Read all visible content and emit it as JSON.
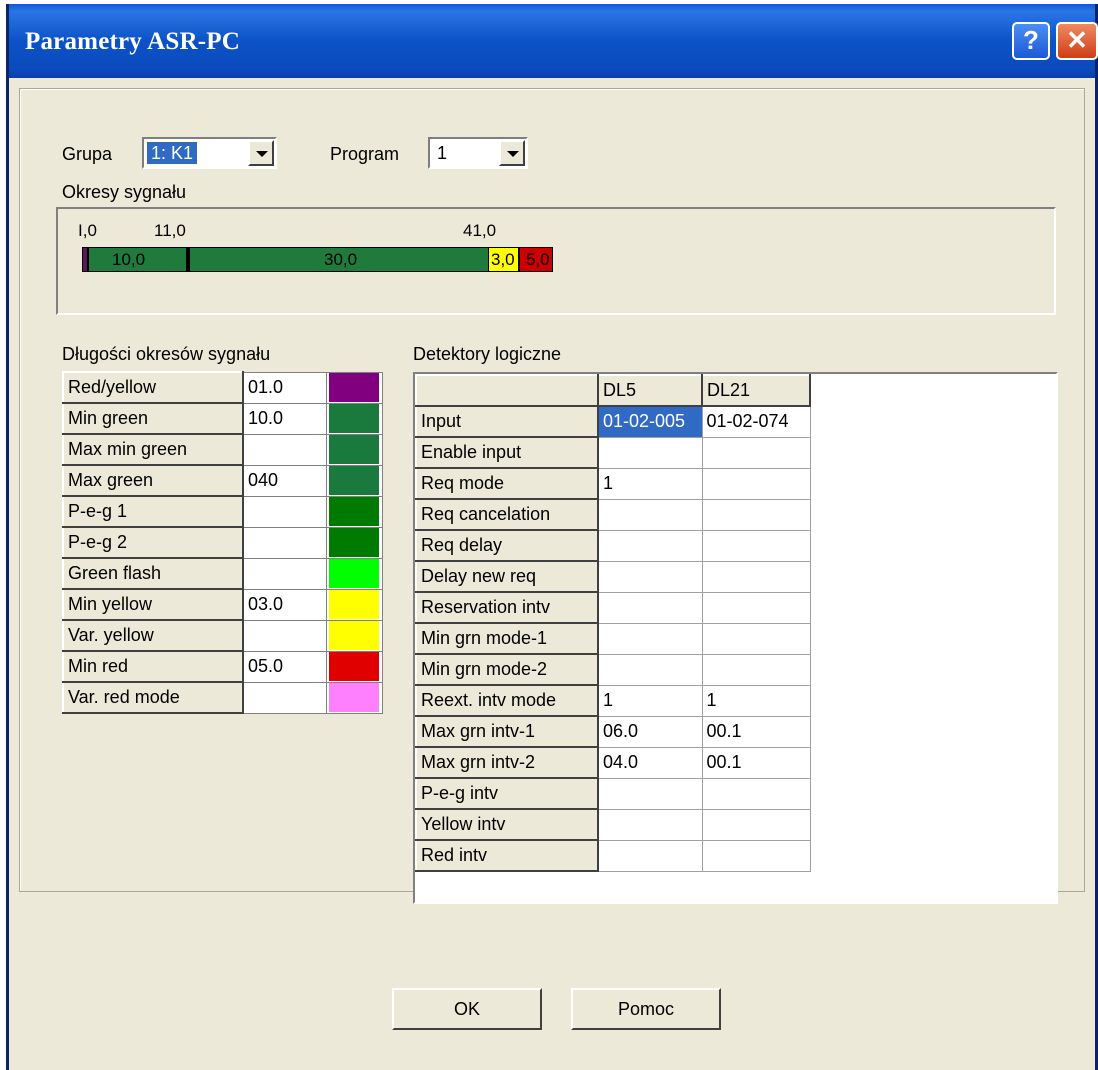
{
  "window": {
    "title": "Parametry ASR-PC",
    "help_label": "?",
    "close_label": "✕"
  },
  "top": {
    "group_label": "Grupa",
    "group_value": "1: K1",
    "program_label": "Program",
    "program_value": "1",
    "periods_label": "Okresy sygnału"
  },
  "timeline": {
    "ticks": [
      "I,0",
      "11,0",
      "41,0"
    ],
    "segments": [
      {
        "label": "",
        "color": "#5a1a5a"
      },
      {
        "label": "10,0",
        "color": "#1f7a3c"
      },
      {
        "label": "30,0",
        "color": "#1f7a3c"
      },
      {
        "label": "3,0",
        "color": "#ffff00"
      },
      {
        "label": "5,0",
        "color": "#cc0000"
      }
    ]
  },
  "signal": {
    "label": "Długości okresów sygnału",
    "rows": [
      {
        "name": "Red/yellow",
        "value": "01.0",
        "color": "#800080"
      },
      {
        "name": "Min green",
        "value": "10.0",
        "color": "#1a7a3e"
      },
      {
        "name": "Max min green",
        "value": "",
        "color": "#1a7a3e"
      },
      {
        "name": "Max green",
        "value": "040",
        "color": "#1a7a3e"
      },
      {
        "name": "P-e-g 1",
        "value": "",
        "color": "#007a00"
      },
      {
        "name": "P-e-g 2",
        "value": "",
        "color": "#007a00"
      },
      {
        "name": "Green flash",
        "value": "",
        "color": "#00ff00"
      },
      {
        "name": "Min yellow",
        "value": "03.0",
        "color": "#ffff00"
      },
      {
        "name": "Var. yellow",
        "value": "",
        "color": "#ffff00"
      },
      {
        "name": "Min red",
        "value": "05.0",
        "color": "#e00000"
      },
      {
        "name": "Var. red mode",
        "value": "",
        "color": "#ff80ff"
      }
    ]
  },
  "detectors": {
    "label": "Detektory logiczne",
    "columns": [
      "DL5",
      "DL21"
    ],
    "rows": [
      {
        "name": "Input",
        "v1": "01-02-005",
        "v2": "01-02-074"
      },
      {
        "name": "Enable input",
        "v1": "",
        "v2": ""
      },
      {
        "name": "Req mode",
        "v1": "1",
        "v2": ""
      },
      {
        "name": "Req cancelation",
        "v1": "",
        "v2": ""
      },
      {
        "name": "Req delay",
        "v1": "",
        "v2": ""
      },
      {
        "name": "Delay new req",
        "v1": "",
        "v2": ""
      },
      {
        "name": "Reservation intv",
        "v1": "",
        "v2": ""
      },
      {
        "name": "Min grn mode-1",
        "v1": "",
        "v2": ""
      },
      {
        "name": "Min grn mode-2",
        "v1": "",
        "v2": ""
      },
      {
        "name": "Reext. intv mode",
        "v1": "1",
        "v2": "1"
      },
      {
        "name": "Max grn intv-1",
        "v1": "06.0",
        "v2": "00.1"
      },
      {
        "name": "Max grn intv-2",
        "v1": "04.0",
        "v2": "00.1"
      },
      {
        "name": "P-e-g intv",
        "v1": "",
        "v2": ""
      },
      {
        "name": "Yellow intv",
        "v1": "",
        "v2": ""
      },
      {
        "name": "Red intv",
        "v1": "",
        "v2": ""
      }
    ]
  },
  "buttons": {
    "ok": "OK",
    "help": "Pomoc"
  }
}
